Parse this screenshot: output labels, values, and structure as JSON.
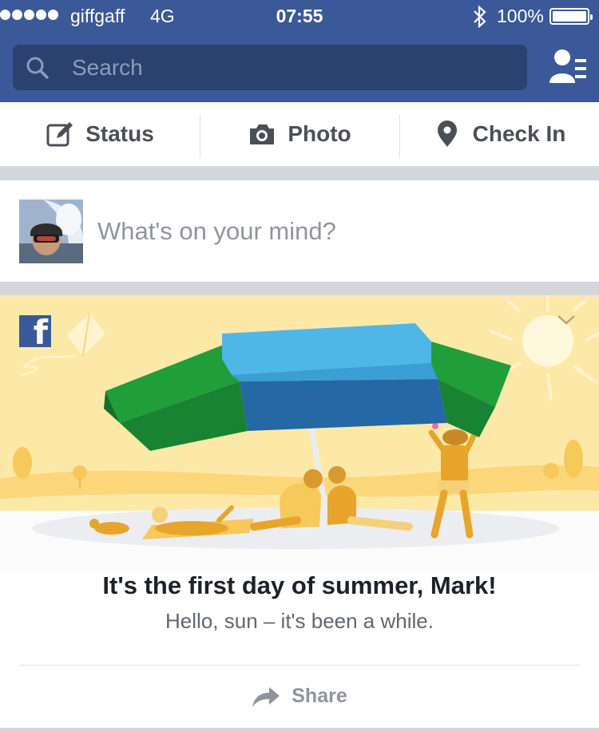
{
  "status_bar": {
    "carrier": "giffgaff",
    "network": "4G",
    "time": "07:55",
    "battery": "100%",
    "signal_bars": 5,
    "bluetooth_icon": "bluetooth-icon"
  },
  "header": {
    "search_placeholder": "Search",
    "search_icon": "search-icon",
    "friends_icon": "friend-requests-icon"
  },
  "actions": {
    "status": {
      "label": "Status",
      "icon": "edit-icon"
    },
    "photo": {
      "label": "Photo",
      "icon": "camera-icon"
    },
    "checkin": {
      "label": "Check In",
      "icon": "location-pin-icon"
    }
  },
  "composer": {
    "prompt": "What's on your mind?"
  },
  "card": {
    "headline": "It's the first day of summer, Mark!",
    "subline": "Hello, sun – it's been a while.",
    "share_label": "Share",
    "logo_text": "f",
    "menu_icon": "chevron-down-icon"
  },
  "colors": {
    "brand": "#3b5998",
    "search_bg": "#2b4170",
    "summer_bg": "#fde9a7",
    "umbrella_green": "#1f9e3a",
    "umbrella_blue": "#4fb7e8"
  }
}
